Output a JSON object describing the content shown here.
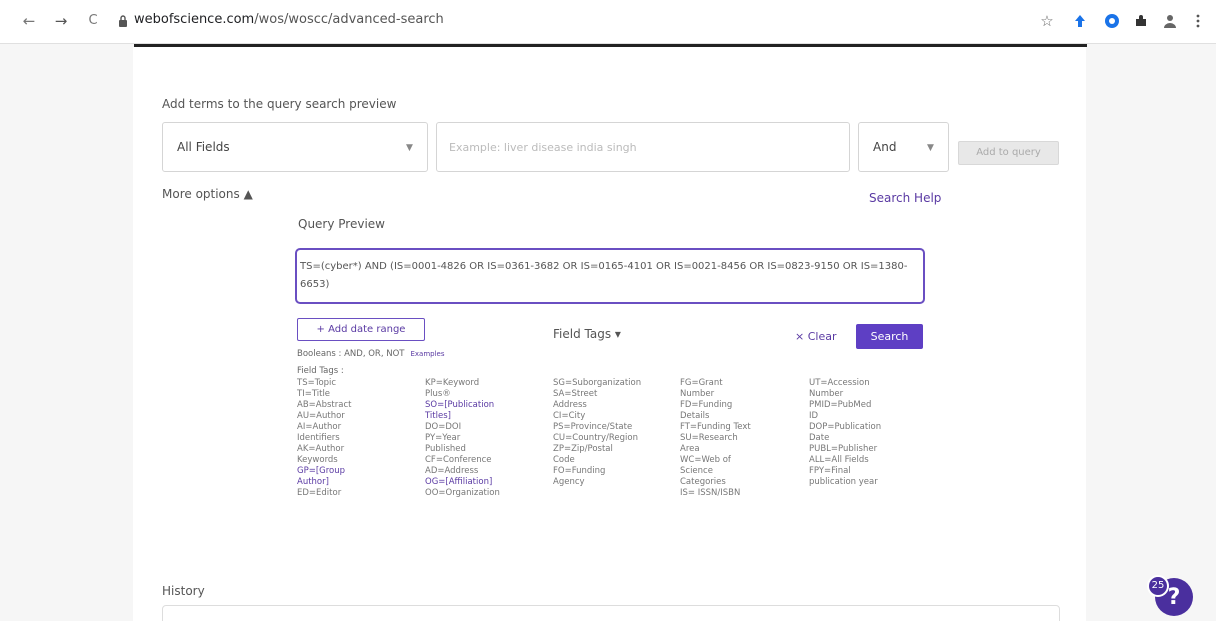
{
  "browser": {
    "url_host": "webofscience.com",
    "url_path": "/wos/woscc/advanced-search",
    "back_icon": "←",
    "forward_icon": "→",
    "reload_icon": "C",
    "star_icon": "☆"
  },
  "builder": {
    "heading": "Add terms to the query search preview",
    "field_value": "All Fields",
    "term_placeholder": "Example: liver disease india singh",
    "bool_value": "And",
    "add_button": "Add to query",
    "more_options": "More options ▲",
    "search_help": "Search Help"
  },
  "preview": {
    "label": "Query Preview",
    "query": "TS=(cyber*) AND (IS=0001-4826 OR IS=0361-3682 OR IS=0165-4101 OR IS=0021-8456 OR IS=0823-9150 OR IS=1380-6653)",
    "add_date": "+ Add date range",
    "field_tags_toggle": "Field Tags ▾",
    "clear": "× Clear",
    "search": "Search"
  },
  "help": {
    "booleans": "Booleans : AND, OR, NOT",
    "examples": "Examples",
    "field_tags_label": "Field Tags :",
    "col1": {
      "l1": "TS=Topic",
      "l2": "TI=Title",
      "l3": "AB=Abstract",
      "l4": "AU=Author",
      "l5": "AI=Author",
      "l6": "Identifiers",
      "l7": "AK=Author",
      "l8": "Keywords",
      "l9": "GP=[Group",
      "l10": "Author]",
      "l11": "ED=Editor"
    },
    "col2": {
      "l1": "KP=Keyword",
      "l2": "Plus®",
      "l3": "SO=[Publication",
      "l4": "Titles]",
      "l5": "DO=DOI",
      "l6": "PY=Year",
      "l7": "Published",
      "l8": "CF=Conference",
      "l9": "AD=Address",
      "l10": "OG=[Affiliation]",
      "l11": "OO=Organization"
    },
    "col3": {
      "l1": "SG=Suborganization",
      "l2": "SA=Street",
      "l3": "Address",
      "l4": "CI=City",
      "l5": "PS=Province/State",
      "l6": "CU=Country/Region",
      "l7": "ZP=Zip/Postal",
      "l8": "Code",
      "l9": "FO=Funding",
      "l10": "Agency"
    },
    "col4": {
      "l1": "FG=Grant",
      "l2": "Number",
      "l3": "FD=Funding",
      "l4": "Details",
      "l5": "FT=Funding Text",
      "l6": "SU=Research",
      "l7": "Area",
      "l8": "WC=Web of",
      "l9": "Science",
      "l10": "Categories",
      "l11": "IS= ISSN/ISBN"
    },
    "col5": {
      "l1": "UT=Accession",
      "l2": "Number",
      "l3": "PMID=PubMed",
      "l4": "ID",
      "l5": "DOP=Publication",
      "l6": "Date",
      "l7": "PUBL=Publisher",
      "l8": "ALL=All Fields",
      "l9": "FPY=Final",
      "l10": "publication year"
    }
  },
  "history": {
    "label": "History"
  },
  "help_widget": {
    "badge": "25",
    "icon": "?"
  },
  "colors": {
    "accent": "#5e3fc4",
    "link": "#5a3aa3"
  }
}
